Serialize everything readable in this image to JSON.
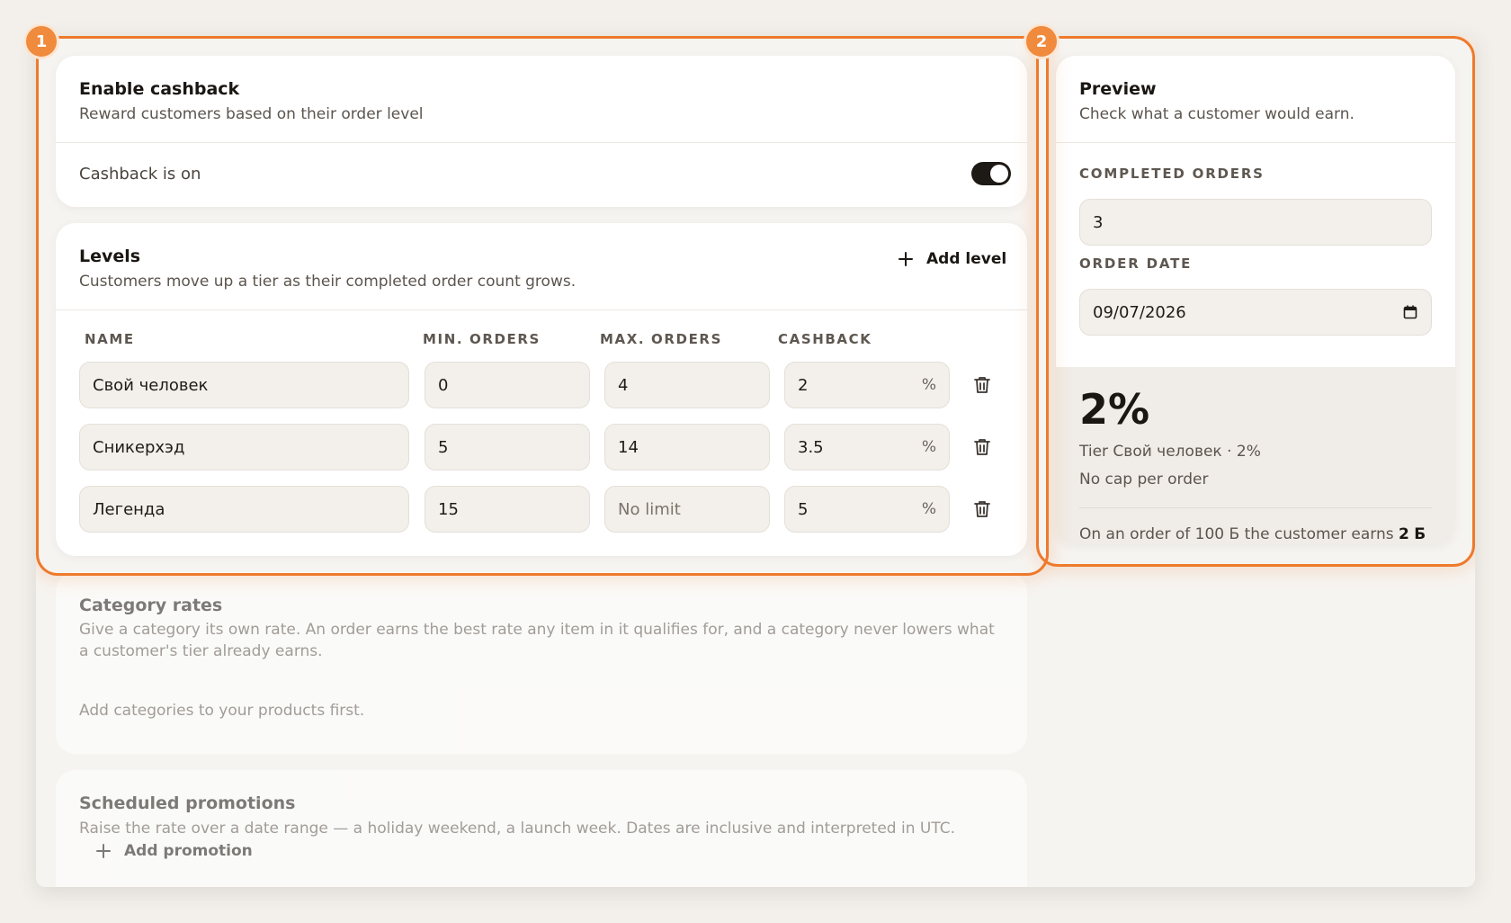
{
  "cashback": {
    "title": "Enable cashback",
    "subtitle": "Reward customers based on their order level",
    "toggle_label": "Cashback is on",
    "toggle_on": true
  },
  "levels": {
    "title": "Levels",
    "subtitle": "Customers move up a tier as their completed order count grows.",
    "add_label": "Add level",
    "columns": [
      "NAME",
      "MIN. ORDERS",
      "MAX. ORDERS",
      "CASHBACK"
    ],
    "percent_suffix": "%",
    "rows": [
      {
        "name": "Свой человек",
        "min": "0",
        "max": "4",
        "cashback": "2"
      },
      {
        "name": "Сникерхэд",
        "min": "5",
        "max": "14",
        "cashback": "3.5"
      },
      {
        "name": "Легенда",
        "min": "15",
        "max": "",
        "max_placeholder": "No limit",
        "cashback": "5"
      }
    ]
  },
  "category": {
    "title": "Category rates",
    "subtitle": "Give a category its own rate. An order earns the best rate any item in it qualifies for, and a category never lowers what a customer's tier already earns.",
    "empty": "Add categories to your products first."
  },
  "promotions": {
    "title": "Scheduled promotions",
    "subtitle": "Raise the rate over a date range — a holiday weekend, a launch week. Dates are inclusive and interpreted in UTC.",
    "add_label": "Add promotion"
  },
  "preview": {
    "title": "Preview",
    "subtitle": "Check what a customer would earn.",
    "orders_label": "COMPLETED ORDERS",
    "orders_value": "3",
    "date_label": "ORDER DATE",
    "date_value": "09/07/2026",
    "rate": "2%",
    "tier_line": "Tier Свой человек · 2%",
    "cap_line": "No cap per order",
    "earn_prefix": "On an order of 100",
    "earn_currency": "Ƃ",
    "earn_middle": "the customer earns",
    "earn_value": "2",
    "earn_currency2": "Ƃ"
  },
  "highlights": {
    "first": "1",
    "second": "2"
  },
  "colors": {
    "accent": "#ee7a2c",
    "toggle": "#1d1915",
    "field_bg": "#f3f0eb"
  },
  "icons": [
    "plus-icon",
    "trash-icon",
    "calendar-icon"
  ]
}
